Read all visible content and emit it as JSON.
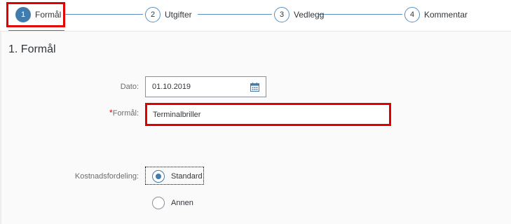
{
  "wizard": {
    "steps": [
      {
        "number": "1",
        "label": "Formål"
      },
      {
        "number": "2",
        "label": "Utgifter"
      },
      {
        "number": "3",
        "label": "Vedlegg"
      },
      {
        "number": "4",
        "label": "Kommentar"
      }
    ],
    "active_step": 1
  },
  "section": {
    "title": "1. Formål"
  },
  "form": {
    "date_label": "Dato:",
    "date_value": "01.10.2019",
    "purpose_label": "Formål:",
    "purpose_required_mark": "*",
    "purpose_value": "Terminalbriller",
    "cost_label": "Kostnadsfordeling:",
    "options": [
      {
        "label": "Standard",
        "selected": true
      },
      {
        "label": "Annen",
        "selected": false
      }
    ]
  },
  "colors": {
    "accent": "#427cac",
    "highlight": "#e00000"
  },
  "icons": {
    "date_picker": "calendar-icon"
  }
}
